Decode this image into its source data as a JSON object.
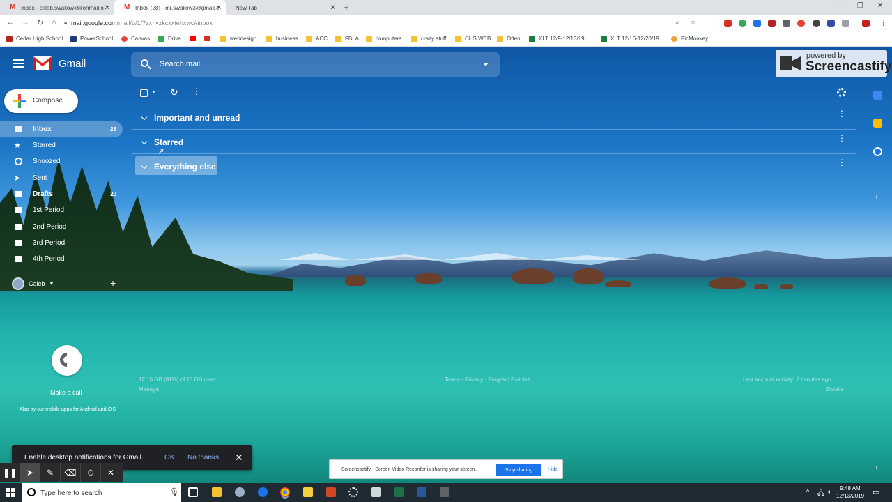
{
  "browser": {
    "tabs": [
      {
        "title": "Inbox - caleb.swallow@ironmail.o",
        "active": false
      },
      {
        "title": "Inbox (28) - mr.swallow3@gmail.c",
        "active": true
      },
      {
        "title": "New Tab",
        "active": false
      }
    ],
    "new_tab": "+",
    "url_host": "mail.google.com",
    "url_path": "/mail/u/1/?zx=yzkcxxtehxwc#inbox",
    "bookmarks": [
      "Cedar High School",
      "PowerSchool",
      "Canvas",
      "Drive",
      "",
      "",
      "webdesign",
      "business",
      "ACC",
      "FBLA",
      "computers",
      "crazy stuff",
      "CHS WEB",
      "Often",
      "XLT 12/9-12/13/19...",
      "XLT 12/16-12/20/19...",
      "PicMonkey"
    ]
  },
  "gmail": {
    "brand": "Gmail",
    "search_placeholder": "Search mail",
    "compose": "Compose",
    "nav": [
      {
        "label": "Inbox",
        "count": "28",
        "active": true,
        "bold": true,
        "icon": "inbox-icon"
      },
      {
        "label": "Starred",
        "count": "",
        "active": false,
        "bold": false,
        "icon": "star-icon"
      },
      {
        "label": "Snoozed",
        "count": "",
        "active": false,
        "bold": false,
        "icon": "clock-icon"
      },
      {
        "label": "Sent",
        "count": "",
        "active": false,
        "bold": false,
        "icon": "send-icon"
      },
      {
        "label": "Drafts",
        "count": "20",
        "active": false,
        "bold": true,
        "icon": "draft-icon"
      },
      {
        "label": "1st Period",
        "count": "",
        "active": false,
        "bold": false,
        "icon": "label-icon"
      },
      {
        "label": "2nd Period",
        "count": "",
        "active": false,
        "bold": false,
        "icon": "label-icon"
      },
      {
        "label": "3rd Period",
        "count": "",
        "active": false,
        "bold": false,
        "icon": "label-icon"
      },
      {
        "label": "4th Period",
        "count": "",
        "active": false,
        "bold": false,
        "icon": "label-icon"
      }
    ],
    "user": "Caleb",
    "sections": [
      {
        "title": "Important and unread"
      },
      {
        "title": "Starred"
      },
      {
        "title": "Everything else"
      }
    ],
    "call_label": "Make a call",
    "call_sub": "Also try our mobile apps for Android and iOS",
    "footer": {
      "storage": "12.16 GB (81%) of 15 GB used",
      "manage": "Manage",
      "links": "Terms · Privacy · Program Policies",
      "activity": "Last account activity: 2 minutes ago",
      "details": "Details"
    },
    "notification": {
      "text": "Enable desktop notifications for Gmail.",
      "ok": "OK",
      "no": "No thanks"
    }
  },
  "screencastify": {
    "powered_by": "powered by",
    "name": "Screencastify",
    "share_text": "Screencastify - Screen Video Recorder is sharing your screen.",
    "stop": "Stop sharing",
    "hide": "Hide"
  },
  "taskbar": {
    "search": "Type here to search",
    "time": "9:48 AM",
    "date": "12/13/2019"
  }
}
